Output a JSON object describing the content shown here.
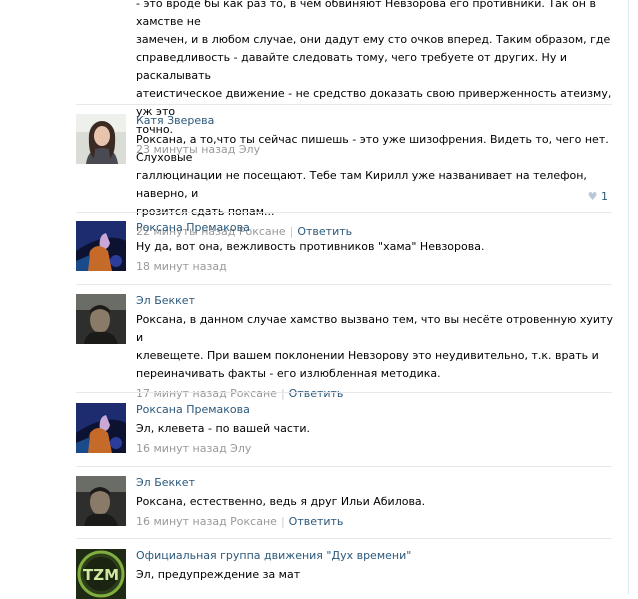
{
  "first_comment": {
    "lines": [
      "- это вроде бы как раз то, в чем обвиняют Невзорова его противники. Так он в хамстве не",
      "замечен, и в любом случае, они дадут ему сто очков вперед. Таким образом, где",
      "справедливость - давайте следовать тому, чего требуете от других. Ну и раскалывать",
      "атеистическое движение - не средство доказать свою приверженность атеизму, уж это",
      "точно."
    ],
    "meta": "23 минуты назад Элу"
  },
  "comments": [
    {
      "author": "Катя Зверева",
      "lines": [
        "Роксана, а то,что ты сейчас пишешь - это уже шизофрения. Видеть то, чего нет. Слуховые",
        "галлюцинации не посещают. Тебе там Кирилл уже названивает на телефон, наверно, и",
        "грозится сдать попам..."
      ],
      "meta": "22 минуты назад Роксане",
      "reply": "Ответить",
      "likes": "1"
    },
    {
      "author": "Роксана Премакова",
      "lines": [
        "Ну да, вот она, вежливость противников \"хама\" Невзорова."
      ],
      "meta": "18 минут назад"
    },
    {
      "author": "Эл Беккет",
      "lines": [
        "Роксана, в данном случае хамство вызвано тем, что вы несёте отровенную хуиту и",
        "клевещете. При вашем поклонении Невзорову это неудивительно, т.к. врать и",
        "переиначивать факты - его излюбленная методика."
      ],
      "meta": "17 минут назад Роксане",
      "reply": "Ответить"
    },
    {
      "author": "Роксана Премакова",
      "lines": [
        "Эл, клевета - по вашей части."
      ],
      "meta": "16 минут назад Элу"
    },
    {
      "author": "Эл Беккет",
      "lines": [
        "Роксана, естественно, ведь я друг Ильи Абилова."
      ],
      "meta": "16 минут назад Роксане",
      "reply": "Ответить"
    },
    {
      "author": "Официальная группа движения \"Дух времени\"",
      "lines": [
        "Эл, предупреждение за мат"
      ],
      "avatar_text": "TZM"
    }
  ]
}
